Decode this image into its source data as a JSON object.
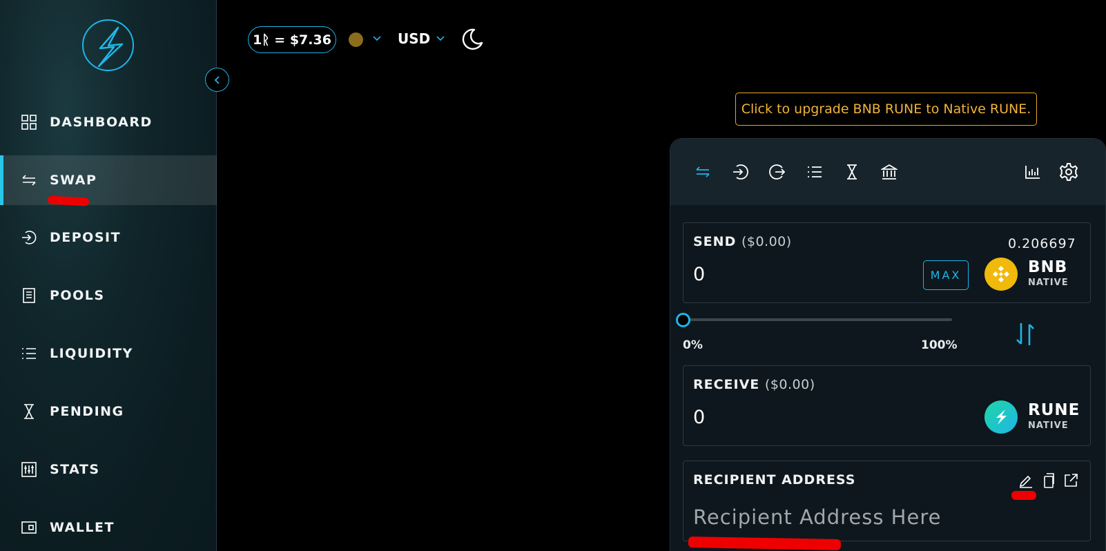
{
  "sidebar": {
    "logo": "thorchain-logo",
    "collapse_icon": "chevron-left-icon",
    "items": [
      {
        "label": "DASHBOARD",
        "icon": "grid-icon"
      },
      {
        "label": "SWAP",
        "icon": "swap-arrows-icon",
        "active": true
      },
      {
        "label": "DEPOSIT",
        "icon": "deposit-icon"
      },
      {
        "label": "POOLS",
        "icon": "pools-icon"
      },
      {
        "label": "LIQUIDITY",
        "icon": "list-icon"
      },
      {
        "label": "PENDING",
        "icon": "hourglass-icon"
      },
      {
        "label": "STATS",
        "icon": "stats-icon"
      },
      {
        "label": "WALLET",
        "icon": "wallet-icon"
      }
    ]
  },
  "header": {
    "rune_price": "1ᚱ = $7.36",
    "network_color": "#8c6d1e",
    "currency": "USD",
    "theme_icon": "moon-icon"
  },
  "banner": {
    "text": "Click to upgrade BNB RUNE to Native RUNE."
  },
  "swap_card": {
    "tabs": [
      "swap-icon",
      "deposit-icon",
      "withdraw-icon",
      "list-icon",
      "hourglass-icon",
      "bank-icon"
    ],
    "right_tabs": [
      "chart-icon",
      "settings-icon"
    ],
    "send": {
      "title": "SEND",
      "usd_value": "($0.00)",
      "amount": "0",
      "max_label": "MAX",
      "balance": "0.206697",
      "asset": "BNB",
      "chain": "NATIVE"
    },
    "slider": {
      "percent": 0,
      "min_label": "0%",
      "max_label": "100%"
    },
    "receive": {
      "title": "RECEIVE",
      "usd_value": "($0.00)",
      "amount": "0",
      "asset": "RUNE",
      "chain": "NATIVE"
    },
    "recipient": {
      "title": "RECIPIENT ADDRESS",
      "placeholder": "Recipient Address Here",
      "icons": [
        "edit-icon",
        "copy-icon",
        "external-link-icon"
      ]
    }
  },
  "colors": {
    "accent": "#1eb6e8",
    "banner": "#f2b33a",
    "annotation": "#e00000"
  }
}
